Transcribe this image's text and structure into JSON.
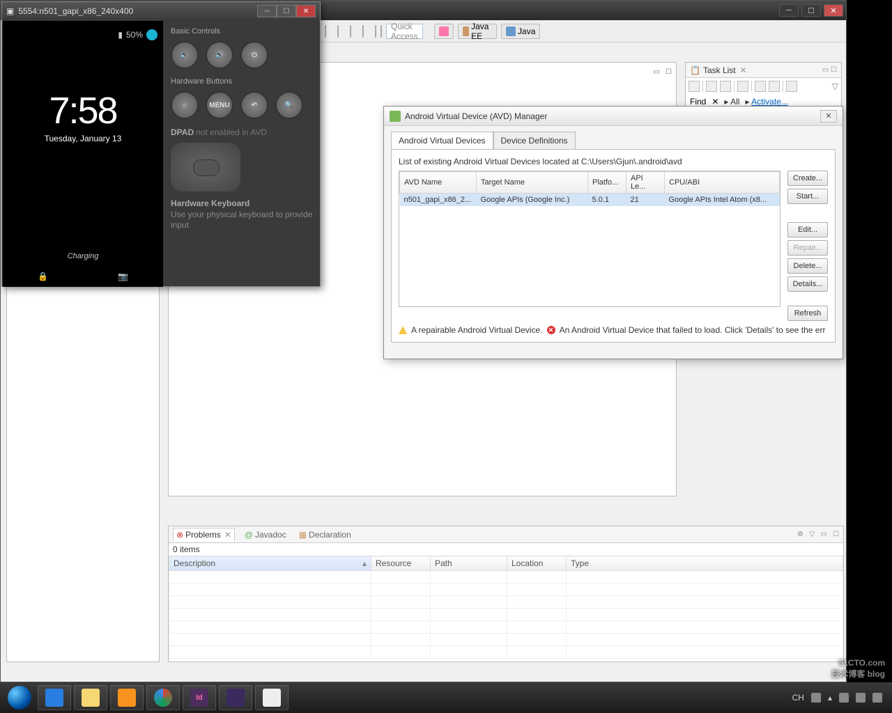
{
  "eclipse": {
    "quick_access": "Quick Access",
    "perspectives": [
      "Java EE",
      "Java"
    ],
    "tasklist": {
      "title": "Task List",
      "find": "Find",
      "all": "All",
      "activate": "Activate..."
    },
    "problems": {
      "tabs": [
        "Problems",
        "Javadoc",
        "Declaration"
      ],
      "items": "0 items",
      "cols": [
        "Description",
        "Resource",
        "Path",
        "Location",
        "Type"
      ]
    }
  },
  "emulator": {
    "title": "5554:n501_gapi_x86_240x400",
    "battery": "50%",
    "time": "7:58",
    "date": "Tuesday, January 13",
    "charging": "Charging",
    "basic_controls": "Basic Controls",
    "hardware_buttons": "Hardware Buttons",
    "menu": "MENU",
    "dpad": "DPAD",
    "dpad_hint": "not enabled in AVD",
    "hw_keyboard": "Hardware Keyboard",
    "hw_keyboard_hint": "Use your physical keyboard to provide input"
  },
  "avd": {
    "title": "Android Virtual Device (AVD) Manager",
    "tabs": [
      "Android Virtual Devices",
      "Device Definitions"
    ],
    "desc": "List of existing Android Virtual Devices located at C:\\Users\\Gjun\\.android\\avd",
    "cols": [
      "AVD Name",
      "Target Name",
      "Platfo...",
      "API Le...",
      "CPU/ABI"
    ],
    "row": {
      "name": "n501_gapi_x86_2...",
      "target": "Google APIs (Google Inc.)",
      "platform": "5.0.1",
      "api": "21",
      "cpu": "Google APIs Intel Atom (x8..."
    },
    "btns": {
      "create": "Create...",
      "start": "Start...",
      "edit": "Edit...",
      "repair": "Repair...",
      "delete": "Delete...",
      "details": "Details...",
      "refresh": "Refresh"
    },
    "foot_warn": "A repairable Android Virtual Device.",
    "foot_err": "An Android Virtual Device that failed to load. Click 'Details' to see the err"
  },
  "taskbar": {
    "lang": "CH",
    "icons": [
      "ie",
      "explorer",
      "player",
      "chrome",
      "id",
      "eclipse",
      "other"
    ]
  },
  "watermark": {
    "l1": "51CTO.com",
    "l2": "技术博客 blog"
  }
}
